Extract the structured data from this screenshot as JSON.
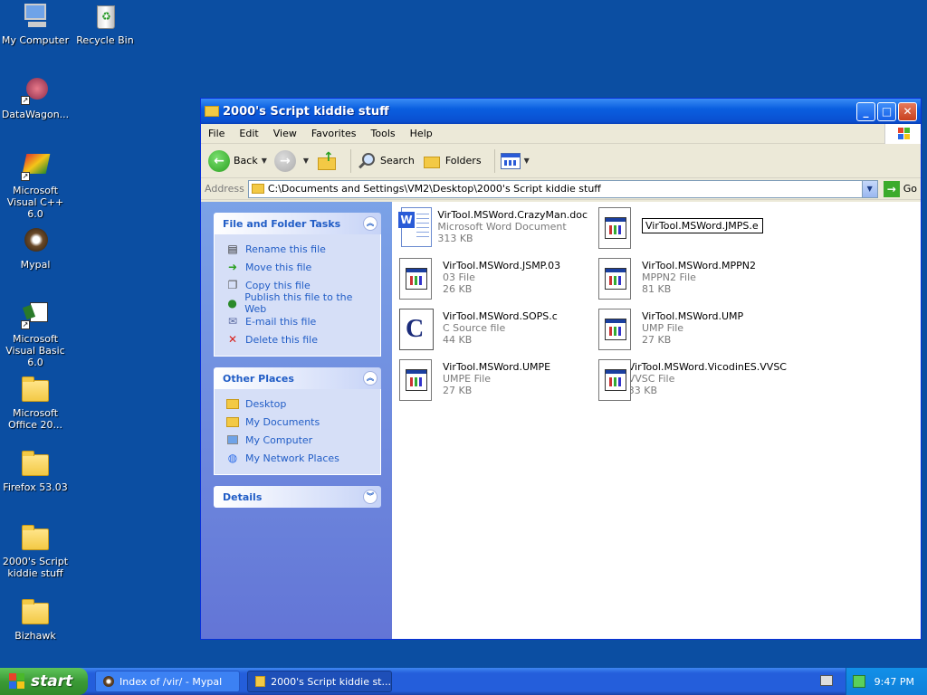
{
  "desktop": {
    "icons": [
      {
        "label": "My Computer"
      },
      {
        "label": "Recycle Bin"
      },
      {
        "label": "DataWagon..."
      },
      {
        "label": "Microsoft Visual C++ 6.0"
      },
      {
        "label": "Mypal"
      },
      {
        "label": "Microsoft Visual Basic 6.0"
      },
      {
        "label": "Microsoft Office 20..."
      },
      {
        "label": "Firefox 53.03"
      },
      {
        "label": "2000's Script kiddie stuff"
      },
      {
        "label": "Bizhawk"
      }
    ]
  },
  "window": {
    "title": "2000's Script kiddie stuff",
    "menu": [
      "File",
      "Edit",
      "View",
      "Favorites",
      "Tools",
      "Help"
    ],
    "toolbar": {
      "back": "Back",
      "search": "Search",
      "folders": "Folders"
    },
    "address": {
      "label": "Address",
      "value": "C:\\Documents and Settings\\VM2\\Desktop\\2000's Script kiddie stuff",
      "go": "Go"
    },
    "tasks": {
      "title": "File and Folder Tasks",
      "items": [
        "Rename this file",
        "Move this file",
        "Copy this file",
        "Publish this file to the Web",
        "E-mail this file",
        "Delete this file"
      ]
    },
    "places": {
      "title": "Other Places",
      "items": [
        "Desktop",
        "My Documents",
        "My Computer",
        "My Network Places"
      ]
    },
    "details": {
      "title": "Details"
    },
    "files": [
      {
        "name": "VirTool.MSWord.CrazyMan.doc",
        "type": "Microsoft Word Document",
        "size": "313 KB",
        "icon": "word-doc-icon"
      },
      {
        "name": "VirTool.MSWord.JMPS.e",
        "type": "",
        "size": "",
        "icon": "generic-file-icon",
        "renaming": true
      },
      {
        "name": "VirTool.MSWord.JSMP.03",
        "type": "03 File",
        "size": "26 KB",
        "icon": "generic-file-icon"
      },
      {
        "name": "VirTool.MSWord.MPPN2",
        "type": "MPPN2 File",
        "size": "81 KB",
        "icon": "generic-file-icon"
      },
      {
        "name": "VirTool.MSWord.SOPS.c",
        "type": "C Source file",
        "size": "44 KB",
        "icon": "c-source-icon"
      },
      {
        "name": "VirTool.MSWord.UMP",
        "type": "UMP File",
        "size": "27 KB",
        "icon": "generic-file-icon"
      },
      {
        "name": "VirTool.MSWord.UMPE",
        "type": "UMPE File",
        "size": "27 KB",
        "icon": "generic-file-icon"
      },
      {
        "name": "VirTool.MSWord.VicodinES.VVSC",
        "type": "VVSC File",
        "size": "33 KB",
        "icon": "generic-file-icon"
      }
    ]
  },
  "taskbar": {
    "start": "start",
    "buttons": [
      {
        "label": "Index of /vir/ - Mypal"
      },
      {
        "label": "2000's Script kiddie st..."
      }
    ],
    "clock": "9:47 PM"
  }
}
